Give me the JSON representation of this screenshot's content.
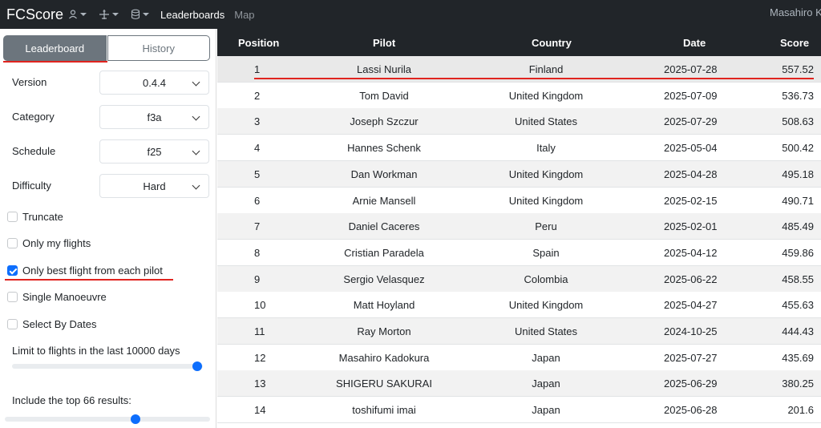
{
  "nav": {
    "brand": "FCScore",
    "links": [
      {
        "label": "Leaderboards",
        "active": true
      },
      {
        "label": "Map",
        "active": false
      }
    ],
    "user": "Masahiro K"
  },
  "sidebar": {
    "tabs": [
      {
        "label": "Leaderboard",
        "active": true
      },
      {
        "label": "History",
        "active": false
      }
    ],
    "fields": [
      {
        "label": "Version",
        "value": "0.4.4"
      },
      {
        "label": "Category",
        "value": "f3a"
      },
      {
        "label": "Schedule",
        "value": "f25"
      },
      {
        "label": "Difficulty",
        "value": "Hard"
      }
    ],
    "checks": [
      {
        "label": "Truncate",
        "checked": false
      },
      {
        "label": "Only my flights",
        "checked": false
      },
      {
        "label": "Only best flight from each pilot",
        "checked": true
      },
      {
        "label": "Single Manoeuvre",
        "checked": false
      },
      {
        "label": "Select By Dates",
        "checked": false
      }
    ],
    "days_label": "Limit to flights in the last 10000 days",
    "days_slider_fraction": 1.0,
    "top_label": "Include the top 66 results:",
    "top_slider_fraction": 0.64
  },
  "table": {
    "headers": {
      "position": "Position",
      "pilot": "Pilot",
      "country": "Country",
      "date": "Date",
      "score": "Score"
    },
    "rows": [
      {
        "position": "1",
        "pilot": "Lassi Nurila",
        "country": "Finland",
        "flag": "fi",
        "date": "2025-07-28",
        "score": "557.52"
      },
      {
        "position": "2",
        "pilot": "Tom David",
        "country": "United Kingdom",
        "flag": "gb",
        "date": "2025-07-09",
        "score": "536.73"
      },
      {
        "position": "3",
        "pilot": "Joseph Szczur",
        "country": "United States",
        "flag": "us",
        "date": "2025-07-29",
        "score": "508.63"
      },
      {
        "position": "4",
        "pilot": "Hannes Schenk",
        "country": "Italy",
        "flag": "it",
        "date": "2025-05-04",
        "score": "500.42"
      },
      {
        "position": "5",
        "pilot": "Dan Workman",
        "country": "United Kingdom",
        "flag": "gb",
        "date": "2025-04-28",
        "score": "495.18"
      },
      {
        "position": "6",
        "pilot": "Arnie Mansell",
        "country": "United Kingdom",
        "flag": "gb",
        "date": "2025-02-15",
        "score": "490.71"
      },
      {
        "position": "7",
        "pilot": "Daniel Caceres",
        "country": "Peru",
        "flag": "pe",
        "date": "2025-02-01",
        "score": "485.49"
      },
      {
        "position": "8",
        "pilot": "Cristian Paradela",
        "country": "Spain",
        "flag": "es",
        "date": "2025-04-12",
        "score": "459.86"
      },
      {
        "position": "9",
        "pilot": "Sergio Velasquez",
        "country": "Colombia",
        "flag": "co",
        "date": "2025-06-22",
        "score": "458.55"
      },
      {
        "position": "10",
        "pilot": "Matt Hoyland",
        "country": "United Kingdom",
        "flag": "gb",
        "date": "2025-04-27",
        "score": "455.63"
      },
      {
        "position": "11",
        "pilot": "Ray Morton",
        "country": "United States",
        "flag": "us",
        "date": "2024-10-25",
        "score": "444.43"
      },
      {
        "position": "12",
        "pilot": "Masahiro Kadokura",
        "country": "Japan",
        "flag": "jp",
        "date": "2025-07-27",
        "score": "435.69"
      },
      {
        "position": "13",
        "pilot": "SHIGERU SAKURAI",
        "country": "Japan",
        "flag": "jp",
        "date": "2025-06-29",
        "score": "380.25"
      },
      {
        "position": "14",
        "pilot": "toshifumi imai",
        "country": "Japan",
        "flag": "jp",
        "date": "2025-06-28",
        "score": "201.6"
      }
    ]
  },
  "colors": {
    "accent": "#0d6efd",
    "highlight_line": "#e0241f",
    "navbar": "#212529"
  }
}
